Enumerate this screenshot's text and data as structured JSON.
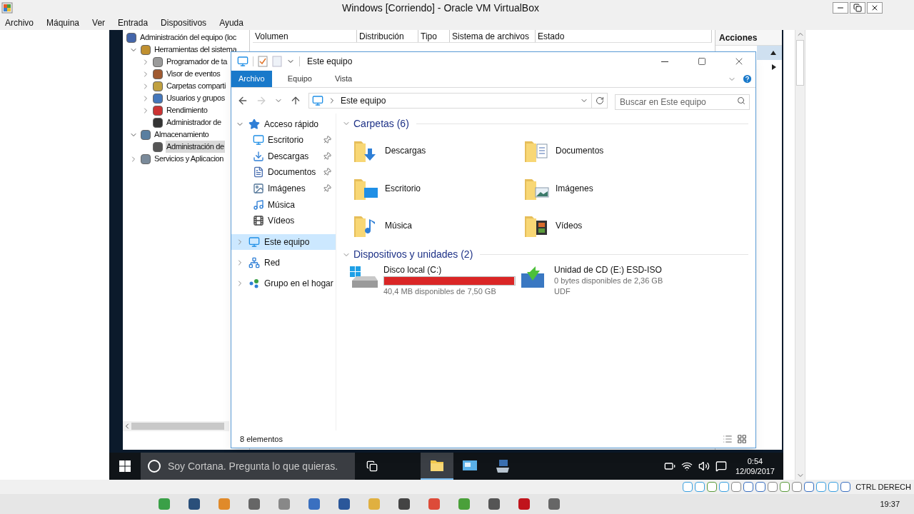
{
  "host_window": {
    "title": "Windows [Corriendo] - Oracle VM VirtualBox",
    "menu": [
      "Archivo",
      "Máquina",
      "Ver",
      "Entrada",
      "Dispositivos",
      "Ayuda"
    ]
  },
  "computer_management": {
    "tree": [
      {
        "label": "Administración del equipo (loc",
        "kind": "root",
        "selected": false,
        "children": [
          {
            "label": "Herramientas del sistema",
            "kind": "expanded",
            "selected": false,
            "children": [
              {
                "label": "Programador de ta",
                "kind": "collapsed",
                "selected": false
              },
              {
                "label": "Visor de eventos",
                "kind": "collapsed",
                "selected": false
              },
              {
                "label": "Carpetas comparti",
                "kind": "collapsed",
                "selected": false
              },
              {
                "label": "Usuarios y grupos",
                "kind": "collapsed",
                "selected": false
              },
              {
                "label": "Rendimiento",
                "kind": "collapsed",
                "selected": false
              },
              {
                "label": "Administrador de",
                "kind": "leaf",
                "selected": false
              }
            ]
          },
          {
            "label": "Almacenamiento",
            "kind": "expanded",
            "selected": false,
            "children": [
              {
                "label": "Administración de",
                "kind": "leaf",
                "selected": true
              }
            ]
          },
          {
            "label": "Servicios y Aplicacion",
            "kind": "collapsed",
            "selected": false
          }
        ]
      }
    ],
    "columns": [
      "Volumen",
      "Distribución",
      "Tipo",
      "Sistema de archivos",
      "Estado"
    ],
    "actions_title": "Acciones"
  },
  "explorer": {
    "title": "Este equipo",
    "ribbon_tabs": [
      {
        "label": "Archivo",
        "selected": true
      },
      {
        "label": "Equipo",
        "selected": false
      },
      {
        "label": "Vista",
        "selected": false
      }
    ],
    "address": "Este equipo",
    "search": {
      "placeholder": "Buscar en Este equipo"
    },
    "nav": [
      {
        "label": "Acceso rápido",
        "kind": "expanded",
        "selected": false,
        "children": [
          {
            "label": "Escritorio",
            "pinned": true,
            "selected": false
          },
          {
            "label": "Descargas",
            "pinned": true,
            "selected": false
          },
          {
            "label": "Documentos",
            "pinned": true,
            "selected": false
          },
          {
            "label": "Imágenes",
            "pinned": true,
            "selected": false
          },
          {
            "label": "Música",
            "pinned": false,
            "selected": false
          },
          {
            "label": "Vídeos",
            "pinned": false,
            "selected": false
          }
        ]
      },
      {
        "label": "Este equipo",
        "kind": "collapsed",
        "selected": true
      },
      {
        "label": "Red",
        "kind": "collapsed",
        "selected": false
      },
      {
        "label": "Grupo en el hogar",
        "kind": "collapsed",
        "selected": false
      }
    ],
    "folders_section": {
      "title": "Carpetas (6)",
      "items": [
        "Descargas",
        "Documentos",
        "Escritorio",
        "Imágenes",
        "Música",
        "Vídeos"
      ]
    },
    "devices_section": {
      "title": "Dispositivos y unidades (2)",
      "items": [
        {
          "kind": "disk",
          "name": "Disco local (C:)",
          "level": 0.995,
          "free": "40,4 MB disponibles de 7,50 GB"
        },
        {
          "kind": "cd",
          "name": "Unidad de CD (E:) ESD-ISO",
          "free": "0 bytes disponibles de 2,36 GB",
          "filesystem": "UDF"
        }
      ]
    },
    "status": "8 elementos"
  },
  "vm_taskbar": {
    "search_placeholder": "Soy Cortana. Pregunta lo que quieras.",
    "apps": [
      {
        "kind": "explorer",
        "selected": true
      },
      {
        "kind": "remote",
        "selected": false
      },
      {
        "kind": "server",
        "selected": false
      }
    ],
    "time": "0:54",
    "date": "12/09/2017"
  },
  "host_status": {
    "key_label": "CTRL DERECH"
  },
  "host_taskbar": {
    "time": "19:37"
  }
}
